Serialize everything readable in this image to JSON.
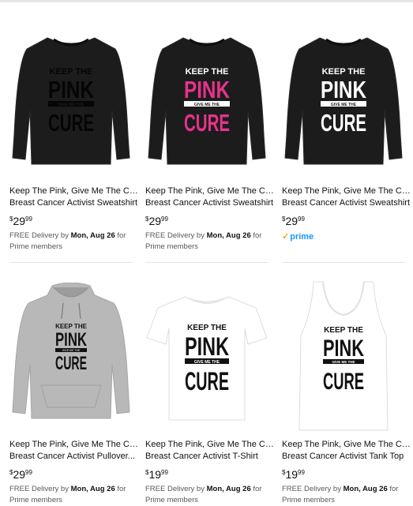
{
  "products": [
    {
      "title_line1": "Keep The Pink, Give Me The Cure",
      "title_line2": "Breast Cancer Activist Sweatshirt",
      "price_symbol": "$",
      "price_dollars": "29",
      "price_cents": "99",
      "delivery_prefix": "FREE Delivery by ",
      "delivery_date": "Mon, Aug 26",
      "delivery_suffix": " for",
      "delivery_line2": "Prime members",
      "design_top": "KEEP THE",
      "design_main": "PINK",
      "design_mid": "GIVE ME THE",
      "design_bottom": "CURE",
      "colors": {
        "garment": "#1c1c1c",
        "print": "#050505",
        "band": "#050505",
        "band_text": "#1c1c1c"
      }
    },
    {
      "title_line1": "Keep The Pink, Give Me The Cure",
      "title_line2": "Breast Cancer Activist Sweatshirt",
      "price_symbol": "$",
      "price_dollars": "29",
      "price_cents": "99",
      "delivery_prefix": "FREE Delivery by ",
      "delivery_date": "Mon, Aug 26",
      "delivery_suffix": " for",
      "delivery_line2": "Prime members",
      "design_top": "KEEP THE",
      "design_main": "PINK",
      "design_mid": "GIVE ME THE",
      "design_bottom": "CURE",
      "colors": {
        "garment": "#1c1c1c",
        "print": "#e6338a",
        "band": "#ffffff",
        "band_text": "#1c1c1c",
        "top_text": "#ffffff"
      }
    },
    {
      "title_line1": "Keep The Pink, Give Me The Cure",
      "title_line2": "Breast Cancer Activist Sweatshirt",
      "price_symbol": "$",
      "price_dollars": "29",
      "price_cents": "99",
      "prime_label": "prime",
      "design_top": "KEEP THE",
      "design_main": "PINK",
      "design_mid": "GIVE ME THE",
      "design_bottom": "CURE",
      "colors": {
        "garment": "#1c1c1c",
        "print": "#ffffff",
        "band": "#ffffff",
        "band_text": "#1c1c1c"
      }
    },
    {
      "title_line1": "Keep The Pink, Give Me The Cure",
      "title_line2": "Breast Cancer Activist Pullover...",
      "price_symbol": "$",
      "price_dollars": "29",
      "price_cents": "99",
      "delivery_prefix": "FREE Delivery by ",
      "delivery_date": "Mon, Aug 26",
      "delivery_suffix": " for",
      "delivery_line2": "Prime members",
      "design_top": "KEEP THE",
      "design_main": "PINK",
      "design_mid": "GIVE ME THE",
      "design_bottom": "CURE",
      "colors": {
        "garment": "#b8b8b8",
        "print": "#111111",
        "band": "#111111",
        "band_text": "#b8b8b8"
      }
    },
    {
      "title_line1": "Keep The Pink, Give Me The Cure",
      "title_line2": "Breast Cancer Activist T-Shirt",
      "price_symbol": "$",
      "price_dollars": "19",
      "price_cents": "99",
      "delivery_prefix": "FREE Delivery by ",
      "delivery_date": "Mon, Aug 26",
      "delivery_suffix": " for",
      "delivery_line2": "Prime members",
      "design_top": "KEEP THE",
      "design_main": "PINK",
      "design_mid": "GIVE ME THE",
      "design_bottom": "CURE",
      "colors": {
        "garment": "#ffffff",
        "print": "#111111",
        "band": "#111111",
        "band_text": "#ffffff"
      }
    },
    {
      "title_line1": "Keep The Pink, Give Me The Cure",
      "title_line2": "Breast Cancer Activist Tank Top",
      "price_symbol": "$",
      "price_dollars": "19",
      "price_cents": "99",
      "delivery_prefix": "FREE Delivery by ",
      "delivery_date": "Mon, Aug 26",
      "delivery_suffix": " for",
      "delivery_line2": "Prime members",
      "design_top": "KEEP THE",
      "design_main": "PINK",
      "design_mid": "GIVE ME THE",
      "design_bottom": "CURE",
      "colors": {
        "garment": "#ffffff",
        "print": "#111111",
        "band": "#111111",
        "band_text": "#ffffff"
      }
    }
  ]
}
